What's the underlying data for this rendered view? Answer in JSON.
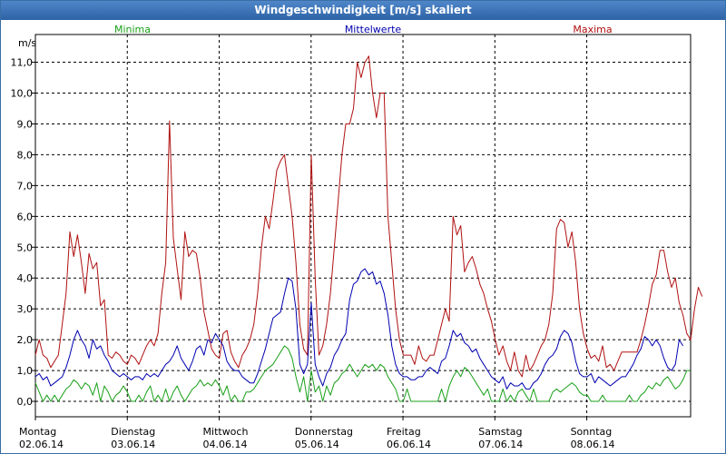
{
  "window": {
    "title": "Windgeschwindigkeit [m/s] skaliert"
  },
  "chart_data": {
    "type": "line",
    "ylabel": "m/s",
    "ylim": [
      -0.5,
      11.9
    ],
    "yticks": [
      0,
      1,
      2,
      3,
      4,
      5,
      6,
      7,
      8,
      9,
      10,
      11
    ],
    "ytick_labels": [
      "0,0",
      "1,0",
      "2,0",
      "3,0",
      "4,0",
      "5,0",
      "6,0",
      "7,0",
      "8,0",
      "9,0",
      "10,0",
      "11,0"
    ],
    "xlim": [
      0,
      7.13
    ],
    "x_step_days": 0.0417,
    "days": [
      {
        "weekday": "Montag",
        "date": "02.06.14"
      },
      {
        "weekday": "Dienstag",
        "date": "03.06.14"
      },
      {
        "weekday": "Mittwoch",
        "date": "04.06.14"
      },
      {
        "weekday": "Donnerstag",
        "date": "05.06.14"
      },
      {
        "weekday": "Freitag",
        "date": "06.06.14"
      },
      {
        "weekday": "Samstag",
        "date": "07.06.14"
      },
      {
        "weekday": "Sonntag",
        "date": "08.06.14"
      }
    ],
    "grid": true,
    "legend_position": "top",
    "series": [
      {
        "name": "Minima",
        "color": "#1aa01a",
        "values": [
          0.6,
          0.3,
          0.0,
          0.2,
          0.0,
          0.2,
          0.0,
          0.2,
          0.4,
          0.5,
          0.7,
          0.6,
          0.4,
          0.6,
          0.5,
          0.2,
          0.6,
          0.0,
          0.5,
          0.3,
          0.0,
          0.2,
          0.3,
          0.5,
          0.3,
          0.0,
          0.0,
          0.2,
          0.0,
          0.3,
          0.5,
          0.0,
          0.2,
          0.0,
          0.4,
          0.0,
          0.3,
          0.5,
          0.2,
          0.0,
          0.2,
          0.4,
          0.5,
          0.7,
          0.5,
          0.6,
          0.5,
          0.7,
          0.5,
          0.2,
          0.5,
          0.0,
          0.2,
          0.0,
          0.0,
          0.3,
          0.3,
          0.4,
          0.6,
          0.8,
          1.0,
          1.1,
          1.2,
          1.4,
          1.6,
          1.8,
          1.7,
          1.4,
          0.8,
          0.3,
          0.8,
          0.0,
          1.0,
          0.3,
          0.5,
          0.0,
          0.5,
          0.2,
          0.6,
          0.7,
          0.9,
          1.0,
          1.2,
          1.0,
          0.8,
          1.0,
          1.2,
          1.1,
          1.2,
          1.0,
          1.2,
          1.1,
          0.8,
          0.6,
          0.4,
          0.0,
          0.0,
          0.4,
          0.0,
          0.0,
          0.0,
          0.0,
          0.0,
          0.0,
          0.0,
          0.0,
          0.4,
          0.0,
          0.5,
          0.8,
          1.0,
          0.8,
          1.1,
          1.0,
          0.8,
          0.6,
          0.4,
          0.2,
          0.4,
          0.0,
          0.0,
          0.0,
          0.4,
          0.0,
          0.2,
          0.0,
          0.3,
          0.4,
          0.2,
          0.0,
          0.4,
          0.0,
          0.0,
          0.0,
          0.0,
          0.3,
          0.4,
          0.3,
          0.4,
          0.5,
          0.6,
          0.5,
          0.3,
          0.2,
          0.2,
          0.0,
          0.0,
          0.0,
          0.2,
          0.0,
          0.0,
          0.0,
          0.0,
          0.0,
          0.0,
          0.2,
          0.0,
          0.0,
          0.2,
          0.3,
          0.5,
          0.4,
          0.6,
          0.5,
          0.7,
          0.8,
          0.6,
          0.4,
          0.5,
          0.7,
          1.0,
          1.0
        ]
      },
      {
        "name": "Mittelwerte",
        "color": "#0000b0",
        "values": [
          0.8,
          0.9,
          0.7,
          0.8,
          0.5,
          0.6,
          0.7,
          0.8,
          1.1,
          1.5,
          2.0,
          2.3,
          2.0,
          1.8,
          1.4,
          2.0,
          1.7,
          1.8,
          1.5,
          1.3,
          1.0,
          0.9,
          0.8,
          0.9,
          0.8,
          0.7,
          0.8,
          0.8,
          0.7,
          0.9,
          0.8,
          0.9,
          0.8,
          1.0,
          1.2,
          1.3,
          1.5,
          1.8,
          1.4,
          1.2,
          1.0,
          1.3,
          1.7,
          1.8,
          1.5,
          2.0,
          1.9,
          2.2,
          2.0,
          1.8,
          1.3,
          1.1,
          1.0,
          1.0,
          0.8,
          0.7,
          0.6,
          0.6,
          0.9,
          1.3,
          1.7,
          2.2,
          2.7,
          2.8,
          2.9,
          3.5,
          4.0,
          3.9,
          3.0,
          1.2,
          0.9,
          1.2,
          3.2,
          1.2,
          0.8,
          0.5,
          0.9,
          1.1,
          1.5,
          1.7,
          2.0,
          2.2,
          3.3,
          3.8,
          3.9,
          4.2,
          4.3,
          4.1,
          4.2,
          3.8,
          3.9,
          3.5,
          2.8,
          1.8,
          1.2,
          0.9,
          0.8,
          0.8,
          0.7,
          0.7,
          0.8,
          0.8,
          1.0,
          1.1,
          1.0,
          0.9,
          1.3,
          1.4,
          1.8,
          2.3,
          2.1,
          2.2,
          1.9,
          1.8,
          1.6,
          1.7,
          1.4,
          1.2,
          1.0,
          0.8,
          0.7,
          0.6,
          0.8,
          0.4,
          0.6,
          0.5,
          0.5,
          0.6,
          0.4,
          0.4,
          0.6,
          0.7,
          0.9,
          1.2,
          1.4,
          1.5,
          1.7,
          2.1,
          2.3,
          2.2,
          1.9,
          1.3,
          0.9,
          0.8,
          0.8,
          0.9,
          0.6,
          0.8,
          0.7,
          0.6,
          0.5,
          0.6,
          0.7,
          0.8,
          0.8,
          1.0,
          1.2,
          1.5,
          1.7,
          2.1,
          2.0,
          1.8,
          2.0,
          1.8,
          1.4,
          1.1,
          1.0,
          1.2,
          2.0,
          1.8
        ]
      },
      {
        "name": "Maxima",
        "color": "#b01010",
        "values": [
          1.5,
          2.0,
          1.5,
          1.4,
          1.1,
          1.3,
          1.5,
          2.5,
          3.5,
          5.5,
          4.7,
          5.4,
          4.5,
          3.5,
          4.8,
          4.3,
          4.5,
          3.1,
          3.3,
          1.5,
          1.4,
          1.6,
          1.5,
          1.3,
          1.2,
          1.5,
          1.4,
          1.2,
          1.5,
          1.8,
          2.0,
          1.8,
          2.2,
          3.5,
          4.5,
          9.1,
          5.3,
          4.3,
          3.3,
          5.5,
          4.7,
          4.9,
          4.8,
          4.0,
          2.9,
          2.3,
          1.7,
          1.5,
          1.4,
          2.2,
          2.3,
          1.6,
          1.3,
          1.1,
          1.5,
          1.7,
          2.0,
          2.5,
          3.5,
          5.0,
          6.0,
          5.6,
          6.5,
          7.5,
          7.8,
          8.0,
          7.0,
          6.0,
          4.5,
          2.5,
          1.7,
          1.5,
          8.0,
          4.0,
          1.5,
          1.8,
          2.5,
          3.5,
          5.0,
          6.5,
          8.0,
          9.0,
          9.0,
          9.5,
          11.0,
          10.5,
          11.0,
          11.2,
          10.0,
          9.2,
          10.0,
          10.0,
          6.0,
          4.5,
          3.0,
          2.0,
          1.5,
          1.5,
          1.5,
          1.2,
          1.8,
          1.4,
          1.3,
          1.5,
          1.5,
          2.0,
          2.5,
          3.0,
          2.6,
          6.0,
          5.4,
          5.7,
          4.2,
          4.5,
          4.7,
          4.3,
          3.8,
          3.5,
          3.0,
          2.6,
          2.0,
          1.5,
          1.8,
          1.3,
          1.0,
          1.6,
          1.0,
          0.8,
          1.5,
          1.0,
          1.2,
          1.5,
          1.8,
          2.0,
          2.5,
          3.5,
          5.6,
          5.9,
          5.8,
          5.0,
          5.5,
          4.5,
          3.0,
          2.2,
          1.7,
          1.4,
          1.5,
          1.3,
          1.8,
          1.1,
          1.2,
          1.0,
          1.3,
          1.6,
          1.6,
          1.6,
          1.6,
          1.6,
          2.0,
          2.5,
          3.1,
          3.8,
          4.1,
          4.9,
          4.9,
          4.2,
          3.7,
          4.0,
          3.2,
          2.8,
          2.2,
          2.0,
          3.0,
          3.7,
          3.4
        ]
      }
    ]
  }
}
